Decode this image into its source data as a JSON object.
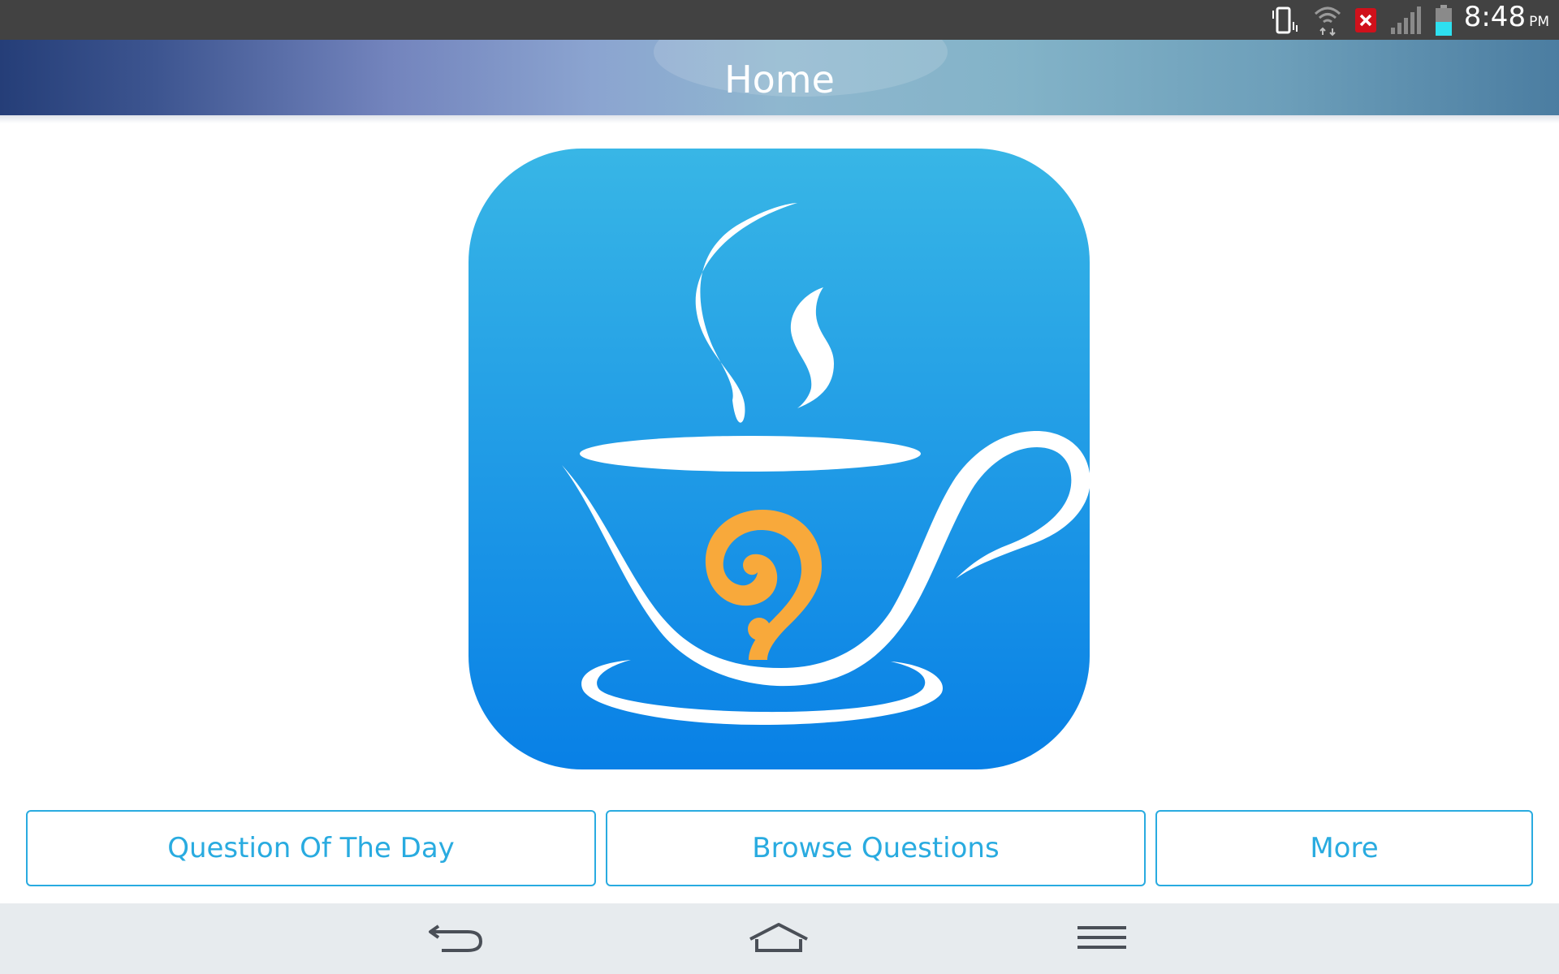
{
  "status_bar": {
    "time": "8:48",
    "ampm": "PM",
    "icons": [
      "vibrate-icon",
      "wifi-icon",
      "error-notification-icon",
      "signal-icon",
      "battery-icon"
    ]
  },
  "action_bar": {
    "title": "Home"
  },
  "main": {
    "logo_icon": "coffee-cup-question-logo",
    "buttons": [
      {
        "label": "Question Of The Day"
      },
      {
        "label": "Browse Questions"
      },
      {
        "label": "More"
      }
    ]
  },
  "nav_bar": {
    "icons": [
      "back-icon",
      "home-icon",
      "menu-icon"
    ]
  },
  "colors": {
    "accent": "#29abe0",
    "status_bar": "#424242",
    "logo_top": "#38b6e6",
    "logo_bottom": "#0880e6",
    "question_mark": "#f8a93b",
    "nav_bar": "#e7ebee"
  }
}
